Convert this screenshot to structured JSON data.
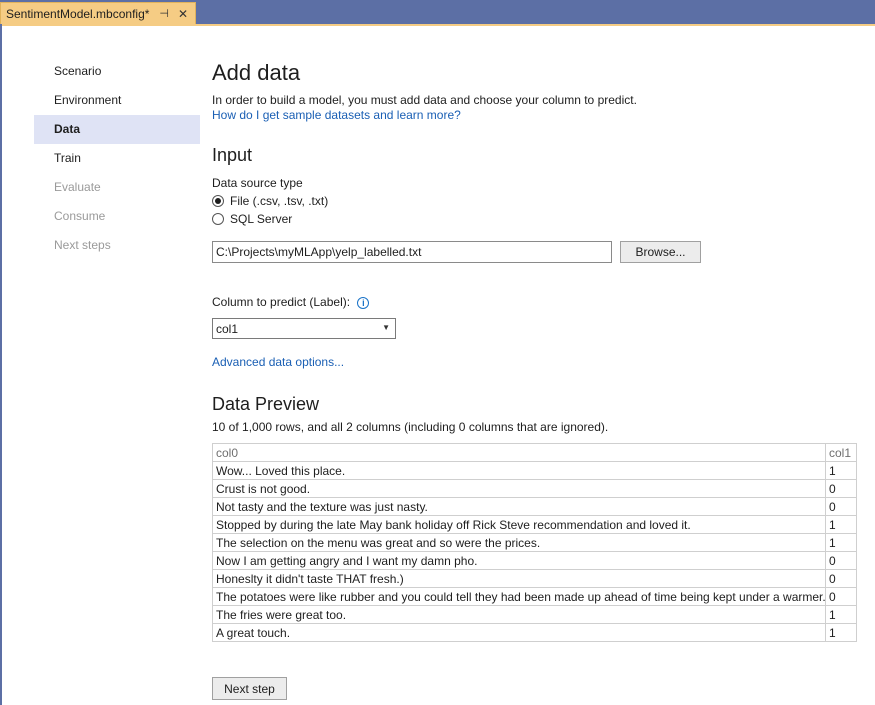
{
  "tab": {
    "title": "SentimentModel.mbconfig*",
    "pin_icon": "pin-icon",
    "close_icon": "close-icon"
  },
  "nav": {
    "items": [
      {
        "label": "Scenario",
        "state": "normal"
      },
      {
        "label": "Environment",
        "state": "normal"
      },
      {
        "label": "Data",
        "state": "active"
      },
      {
        "label": "Train",
        "state": "normal"
      },
      {
        "label": "Evaluate",
        "state": "disabled"
      },
      {
        "label": "Consume",
        "state": "disabled"
      },
      {
        "label": "Next steps",
        "state": "disabled"
      }
    ]
  },
  "main": {
    "title": "Add data",
    "intro": "In order to build a model, you must add data and choose your column to predict.",
    "help_link": "How do I get sample datasets and learn more?",
    "input_heading": "Input",
    "source_type_label": "Data source type",
    "source_options": [
      {
        "label": "File (.csv, .tsv, .txt)",
        "checked": true
      },
      {
        "label": "SQL Server",
        "checked": false
      }
    ],
    "file_path": "C:\\Projects\\myMLApp\\yelp_labelled.txt",
    "browse_label": "Browse...",
    "predict_label": "Column to predict (Label):",
    "predict_value": "col1",
    "advanced_link": "Advanced data options...",
    "preview_heading": "Data Preview",
    "preview_summary": "10 of 1,000 rows, and all 2 columns (including 0 columns that are ignored).",
    "next_label": "Next step"
  },
  "preview": {
    "columns": [
      "col0",
      "col1"
    ],
    "rows": [
      [
        "Wow... Loved this place.",
        "1"
      ],
      [
        "Crust is not good.",
        "0"
      ],
      [
        "Not tasty and the texture was just nasty.",
        "0"
      ],
      [
        "Stopped by during the late May bank holiday off Rick Steve recommendation and loved it.",
        "1"
      ],
      [
        "The selection on the menu was great and so were the prices.",
        "1"
      ],
      [
        "Now I am getting angry and I want my damn pho.",
        "0"
      ],
      [
        "Honeslty it didn't taste THAT fresh.)",
        "0"
      ],
      [
        "The potatoes were like rubber and you could tell they had been made up ahead of time being kept under a warmer.",
        "0"
      ],
      [
        "The fries were great too.",
        "1"
      ],
      [
        "A great touch.",
        "1"
      ]
    ]
  },
  "colors": {
    "tab_strip": "#5c6fa5",
    "active_tab": "#f5cc84",
    "nav_active": "#dfe3f5",
    "link": "#1a5fb4"
  }
}
